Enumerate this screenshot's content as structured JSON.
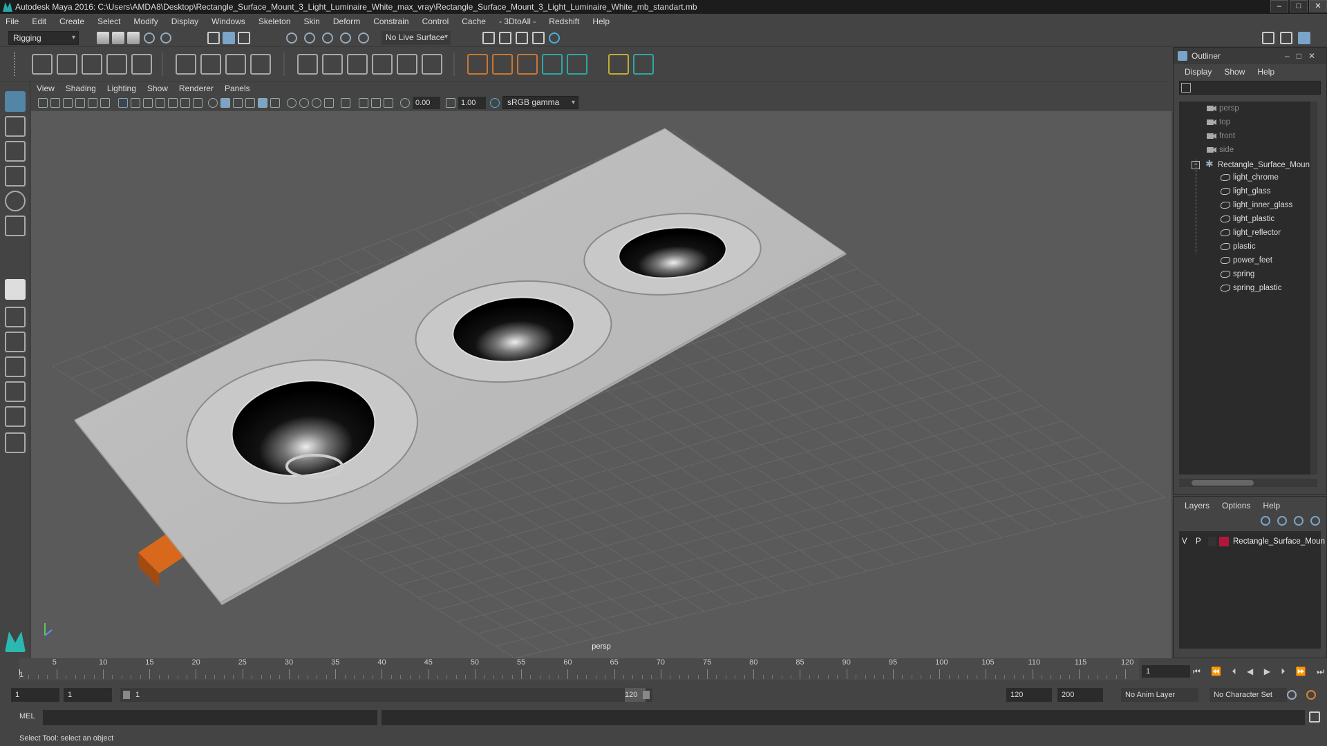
{
  "title": "Autodesk Maya 2016: C:\\Users\\AMDA8\\Desktop\\Rectangle_Surface_Mount_3_Light_Luminaire_White_max_vray\\Rectangle_Surface_Mount_3_Light_Luminaire_White_mb_standart.mb",
  "menubar": [
    "File",
    "Edit",
    "Create",
    "Select",
    "Modify",
    "Display",
    "Windows",
    "Skeleton",
    "Skin",
    "Deform",
    "Constrain",
    "Control",
    "Cache",
    "- 3DtoAll -",
    "Redshift",
    "Help"
  ],
  "statusline": {
    "menu_set": "Rigging",
    "live_surface": "No Live Surface"
  },
  "viewport": {
    "menu": [
      "View",
      "Shading",
      "Lighting",
      "Show",
      "Renderer",
      "Panels"
    ],
    "exposure": "0.00",
    "gamma": "1.00",
    "color_space": "sRGB gamma",
    "camera_label": "persp"
  },
  "outliner": {
    "title": "Outliner",
    "menu": [
      "Display",
      "Show",
      "Help"
    ],
    "items": [
      {
        "label": "persp",
        "type": "camera"
      },
      {
        "label": "top",
        "type": "camera"
      },
      {
        "label": "front",
        "type": "camera"
      },
      {
        "label": "side",
        "type": "camera"
      },
      {
        "label": "Rectangle_Surface_Moun",
        "type": "group"
      },
      {
        "label": "light_chrome",
        "type": "mesh"
      },
      {
        "label": "light_glass",
        "type": "mesh"
      },
      {
        "label": "light_inner_glass",
        "type": "mesh"
      },
      {
        "label": "light_plastic",
        "type": "mesh"
      },
      {
        "label": "light_reflector",
        "type": "mesh"
      },
      {
        "label": "plastic",
        "type": "mesh"
      },
      {
        "label": "power_feet",
        "type": "mesh"
      },
      {
        "label": "spring",
        "type": "mesh"
      },
      {
        "label": "spring_plastic",
        "type": "mesh"
      }
    ]
  },
  "layers": {
    "menu": [
      "Layers",
      "Options",
      "Help"
    ],
    "row": {
      "v": "V",
      "p": "P",
      "name": "Rectangle_Surface_Moun",
      "color": "#b0183a"
    }
  },
  "timeline": {
    "ticks": [
      "5",
      "10",
      "15",
      "20",
      "25",
      "30",
      "35",
      "40",
      "45",
      "50",
      "55",
      "60",
      "65",
      "70",
      "75",
      "80",
      "85",
      "90",
      "95",
      "100",
      "105",
      "110",
      "115",
      "120"
    ],
    "start_tick": "1",
    "current_frame": "1"
  },
  "range": {
    "start": "1",
    "playback_start": "1",
    "slider_start": "1",
    "slider_end": "120",
    "playback_end": "120",
    "end": "200",
    "anim_layer": "No Anim Layer",
    "char_set": "No Character Set"
  },
  "cmdline": {
    "label": "MEL"
  },
  "helpline": "Select Tool: select an object",
  "colors": {
    "accent": "#5285a6",
    "bracket": "#d8681c"
  }
}
